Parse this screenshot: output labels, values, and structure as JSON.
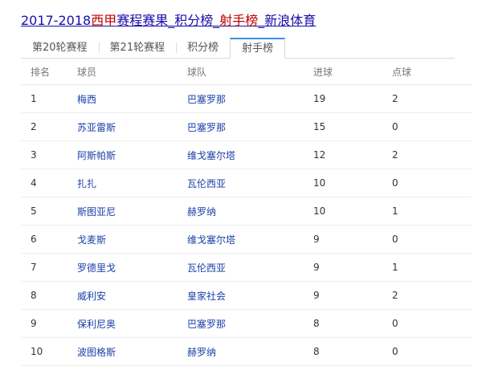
{
  "title": {
    "parts": [
      {
        "text": "2017-2018",
        "highlight": false
      },
      {
        "text": "西甲",
        "highlight": true
      },
      {
        "text": "赛程赛果_积分榜_",
        "highlight": false
      },
      {
        "text": "射手榜",
        "highlight": true
      },
      {
        "text": "_新浪体育",
        "highlight": false
      }
    ]
  },
  "tabs": [
    {
      "label": "第20轮赛程",
      "active": false
    },
    {
      "label": "第21轮赛程",
      "active": false
    },
    {
      "label": "积分榜",
      "active": false
    },
    {
      "label": "射手榜",
      "active": true
    }
  ],
  "table": {
    "headers": [
      "排名",
      "球员",
      "球队",
      "进球",
      "点球"
    ],
    "rows": [
      [
        "1",
        "梅西",
        "巴塞罗那",
        "19",
        "2"
      ],
      [
        "2",
        "苏亚雷斯",
        "巴塞罗那",
        "15",
        "0"
      ],
      [
        "3",
        "阿斯帕斯",
        "维戈塞尔塔",
        "12",
        "2"
      ],
      [
        "4",
        "扎扎",
        "瓦伦西亚",
        "10",
        "0"
      ],
      [
        "5",
        "斯图亚尼",
        "赫罗纳",
        "10",
        "1"
      ],
      [
        "6",
        "戈麦斯",
        "维戈塞尔塔",
        "9",
        "0"
      ],
      [
        "7",
        "罗德里戈",
        "瓦伦西亚",
        "9",
        "1"
      ],
      [
        "8",
        "威利安",
        "皇家社会",
        "9",
        "2"
      ],
      [
        "9",
        "保利尼奥",
        "巴塞罗那",
        "8",
        "0"
      ],
      [
        "10",
        "波图格斯",
        "赫罗纳",
        "8",
        "0"
      ]
    ]
  },
  "colors": {
    "link": "#1a0dab",
    "highlight": "#c00000",
    "tab_accent": "#3a8ee6",
    "table_link": "#1a3fa8"
  }
}
